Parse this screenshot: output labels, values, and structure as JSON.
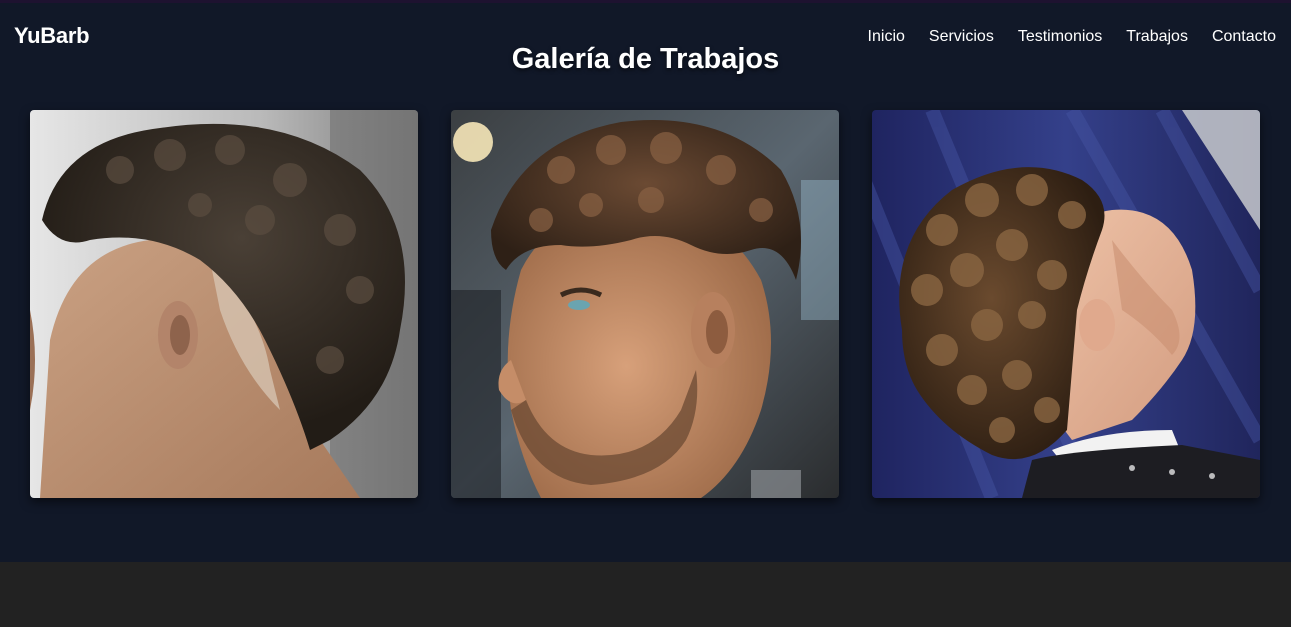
{
  "brand": {
    "name": "YuBarb"
  },
  "nav": {
    "items": [
      {
        "label": "Inicio"
      },
      {
        "label": "Servicios"
      },
      {
        "label": "Testimonios"
      },
      {
        "label": "Trabajos"
      },
      {
        "label": "Contacto"
      }
    ]
  },
  "gallery": {
    "title": "Galería de Trabajos",
    "photos": [
      {
        "subject": "mullet haircut with high fade, rear side view"
      },
      {
        "subject": "textured crop with mid fade and beard, side profile"
      },
      {
        "subject": "curly mullet with drop fade, side view against blue curtain"
      }
    ]
  },
  "colors": {
    "section_bg": "#111828",
    "footer_bg": "#222222",
    "text": "#ffffff"
  }
}
